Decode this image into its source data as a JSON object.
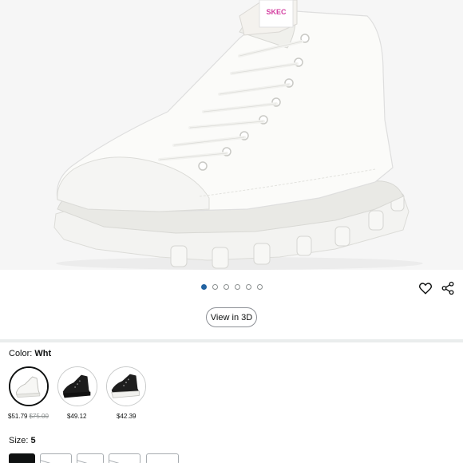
{
  "colors": {
    "accent_dot": "#2162a1",
    "divider": "#eaeded",
    "text": "#0f1111"
  },
  "product_image": {
    "brand_tag_text": "SKEC",
    "description": "white canvas high-top sneaker with lug sole"
  },
  "carousel": {
    "dot_count": 6,
    "active_index": 0
  },
  "actions": {
    "wishlist_icon": "heart-icon",
    "share_icon": "share-icon"
  },
  "view_3d": {
    "label": "View in 3D"
  },
  "color_selector": {
    "label": "Color:",
    "selected_value": "Wht",
    "options": [
      {
        "price": "$51.79",
        "list_price": "$75.00",
        "swatch": "white"
      },
      {
        "price": "$49.12",
        "swatch": "black"
      },
      {
        "price": "$42.39",
        "swatch": "black-white"
      }
    ]
  },
  "size_selector": {
    "label": "Size:",
    "selected_value": "5",
    "options": [
      {
        "state": "selected"
      },
      {
        "state": "unavailable"
      },
      {
        "state": "unavailable"
      },
      {
        "state": "unavailable"
      },
      {
        "state": "available"
      }
    ]
  }
}
